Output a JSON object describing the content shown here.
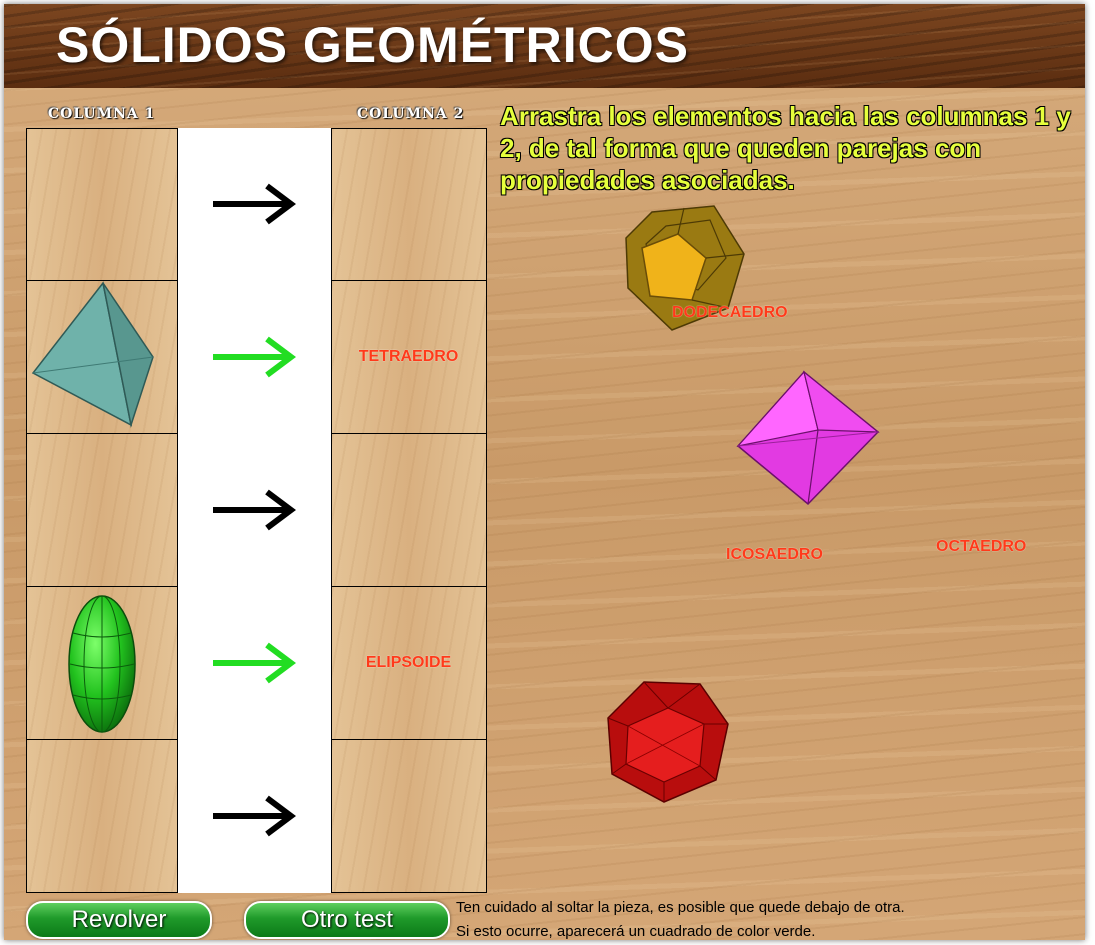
{
  "title": "SÓLIDOS GEOMÉTRICOS",
  "columns": {
    "col1": "COLUMNA 1",
    "col2": "COLUMNA 2"
  },
  "instructions": "Arrastra los elementos hacia las columnas 1 y 2, de tal forma que queden parejas con propiedades asociadas.",
  "rows": [
    {
      "left_solid": "",
      "arrow_color": "#000000",
      "answer": ""
    },
    {
      "left_solid": "tetrahedron-icon",
      "arrow_color": "#22dd22",
      "answer": "TETRAEDRO"
    },
    {
      "left_solid": "",
      "arrow_color": "#000000",
      "answer": ""
    },
    {
      "left_solid": "ellipsoid-icon",
      "arrow_color": "#22dd22",
      "answer": "ELIPSOIDE"
    },
    {
      "left_solid": "",
      "arrow_color": "#000000",
      "answer": ""
    }
  ],
  "free_labels": {
    "dodecaedro": "DODECAEDRO",
    "icosaedro": "ICOSAEDRO",
    "octaedro": "OCTAEDRO"
  },
  "free_solids": [
    "dodecahedron-icon",
    "octahedron-icon",
    "icosahedron-icon"
  ],
  "buttons": {
    "shuffle": "Revolver",
    "other_test": "Otro test"
  },
  "footer_note": {
    "line1": "Ten cuidado al soltar la pieza, es posible que quede debajo de otra.",
    "line2": "Si esto ocurre, aparecerá un cuadrado de color verde."
  }
}
